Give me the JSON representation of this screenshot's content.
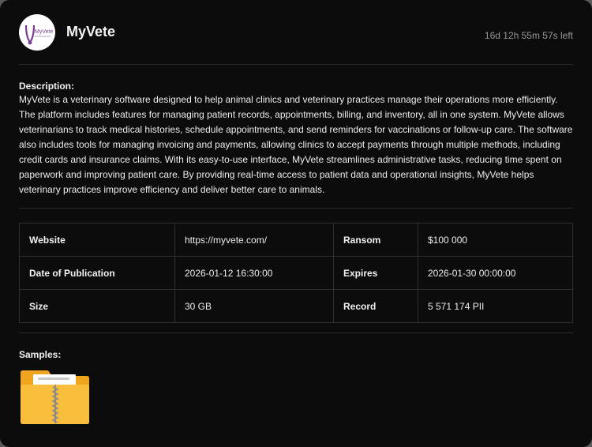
{
  "header": {
    "logo_text": "MyVete",
    "title": "MyVete",
    "timer": "16d 12h 55m 57s left"
  },
  "description": {
    "label": "Description:",
    "text": "MyVete is a veterinary software designed to help animal clinics and veterinary practices manage their operations more efficiently. The platform includes features for managing patient records, appointments, billing, and inventory, all in one system. MyVete allows veterinarians to track medical histories, schedule appointments, and send reminders for vaccinations or follow-up care. The software also includes tools for managing invoicing and payments, allowing clinics to accept payments through multiple methods, including credit cards and insurance claims. With its easy-to-use interface, MyVete streamlines administrative tasks, reducing time spent on paperwork and improving patient care. By providing real-time access to patient data and operational insights, MyVete helps veterinary practices improve efficiency and deliver better care to animals."
  },
  "info": {
    "rows": [
      {
        "k1": "Website",
        "v1": "https://myvete.com/",
        "k2": "Ransom",
        "v2": "$100 000"
      },
      {
        "k1": "Date of Publication",
        "v1": "2026-01-12 16:30:00",
        "k2": "Expires",
        "v2": "2026-01-30 00:00:00"
      },
      {
        "k1": "Size",
        "v1": "30 GB",
        "k2": "Record",
        "v2": "5 571 174 PII"
      }
    ]
  },
  "samples": {
    "label": "Samples:",
    "icon": "zip-folder-icon"
  },
  "colors": {
    "background": "#0c0c0d",
    "logo_purple": "#7a3d8e",
    "folder_yellow": "#f5b82e"
  }
}
